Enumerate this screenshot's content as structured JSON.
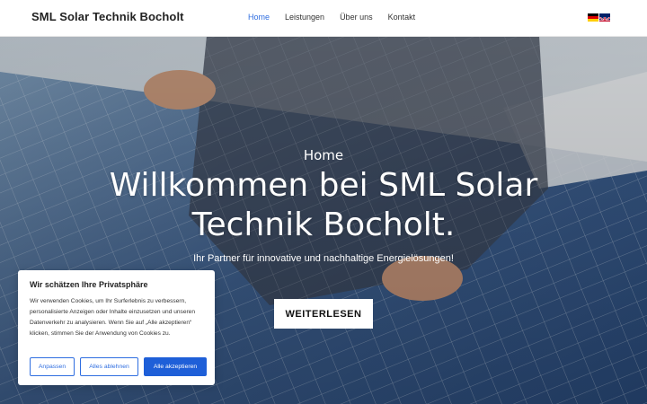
{
  "header": {
    "logo": "SML Solar Technik Bocholt",
    "nav": [
      "Home",
      "Leistungen",
      "Über uns",
      "Kontakt"
    ],
    "active_nav": "Home",
    "languages": [
      "de-flag-icon",
      "en-flag-icon"
    ]
  },
  "hero": {
    "kicker": "Home",
    "heading": "Willkommen bei SML Solar Technik Bocholt.",
    "subtitle": "Ihr Partner für innovative und nachhaltige Energielösungen!",
    "button": "WEITERLESEN"
  },
  "cookie": {
    "title": "Wir schätzen Ihre Privatsphäre",
    "text": "Wir verwenden Cookies, um Ihr Surferlebnis zu verbessern, personalisierte Anzeigen oder Inhalte einzusetzen und unseren Datenverkehr zu analysieren. Wenn Sie auf „Alle akzeptieren“ klicken, stimmen Sie der Anwendung von Cookies zu.",
    "buttons": {
      "customize": "Anpassen",
      "reject": "Alles ablehnen",
      "accept": "Alle akzeptieren"
    }
  },
  "colors": {
    "accent": "#2f6ee0",
    "accept_bg": "#1e5fd8"
  }
}
